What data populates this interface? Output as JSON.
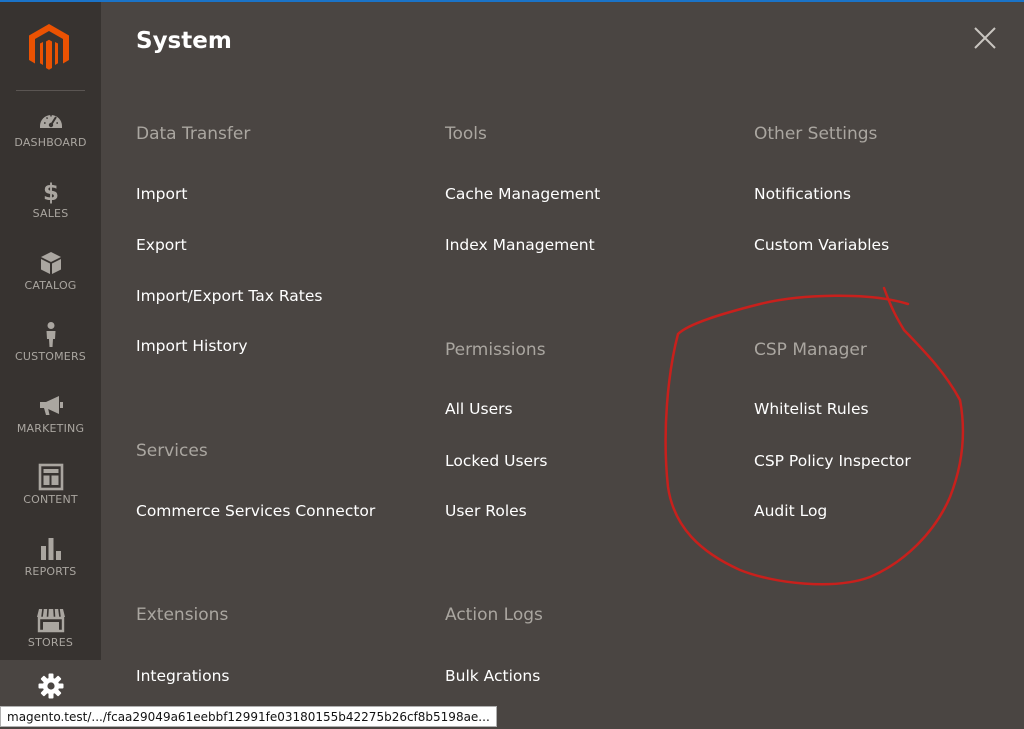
{
  "sidebar": {
    "items": [
      {
        "label": "DASHBOARD",
        "icon": "dashboard-icon"
      },
      {
        "label": "SALES",
        "icon": "dollar-icon"
      },
      {
        "label": "CATALOG",
        "icon": "box-icon"
      },
      {
        "label": "CUSTOMERS",
        "icon": "person-icon"
      },
      {
        "label": "MARKETING",
        "icon": "megaphone-icon"
      },
      {
        "label": "CONTENT",
        "icon": "layout-icon"
      },
      {
        "label": "REPORTS",
        "icon": "bar-chart-icon"
      },
      {
        "label": "STORES",
        "icon": "storefront-icon"
      },
      {
        "label": "",
        "icon": "gear-icon"
      }
    ]
  },
  "panel": {
    "title": "System"
  },
  "sections": {
    "data_transfer": {
      "title": "Data Transfer",
      "links": [
        "Import",
        "Export",
        "Import/Export Tax Rates",
        "Import History"
      ]
    },
    "services": {
      "title": "Services",
      "links": [
        "Commerce Services Connector"
      ]
    },
    "extensions": {
      "title": "Extensions",
      "links": [
        "Integrations"
      ]
    },
    "tools": {
      "title": "Tools",
      "links": [
        "Cache Management",
        "Index Management"
      ]
    },
    "permissions": {
      "title": "Permissions",
      "links": [
        "All Users",
        "Locked Users",
        "User Roles"
      ]
    },
    "action_logs": {
      "title": "Action Logs",
      "links": [
        "Bulk Actions"
      ]
    },
    "other_settings": {
      "title": "Other Settings",
      "links": [
        "Notifications",
        "Custom Variables"
      ]
    },
    "csp_manager": {
      "title": "CSP Manager",
      "links": [
        "Whitelist Rules",
        "CSP Policy Inspector",
        "Audit Log"
      ]
    }
  },
  "status_url": "magento.test/.../fcaa29049a61eebbf12991fe03180155b42275b26cf8b5198ae...",
  "colors": {
    "background": "#4a4542",
    "sidebar": "#373330",
    "logo": "#eb5202",
    "section_title": "#aaa6a0",
    "annotation": "#c8201c"
  }
}
